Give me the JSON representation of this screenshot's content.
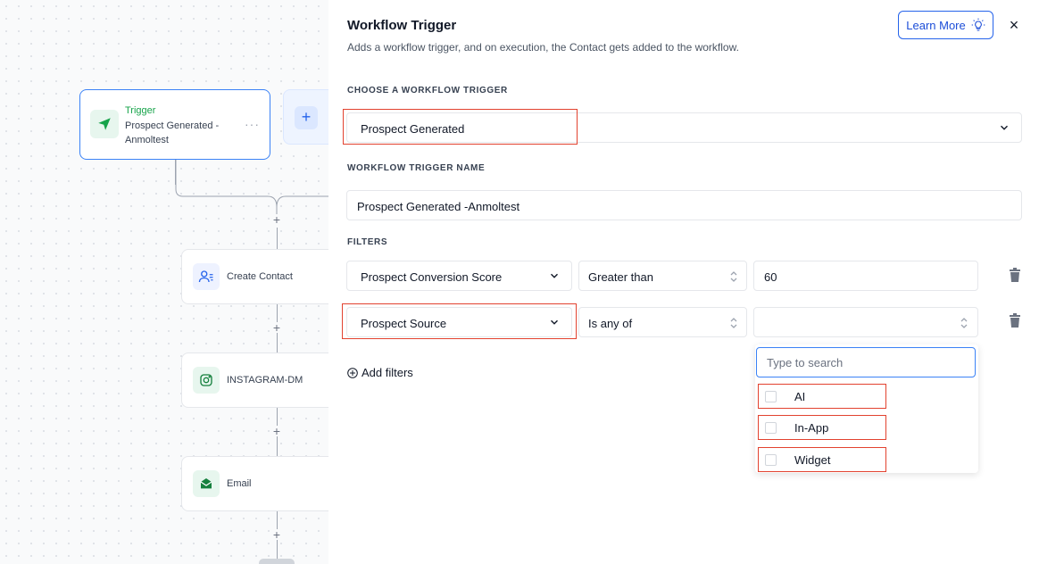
{
  "canvas": {
    "trigger_card": {
      "label": "Trigger",
      "name": "Prospect Generated -\nAnmoltest",
      "more": "···"
    },
    "add_node": "+",
    "plus_sign": "+",
    "nodes": [
      {
        "label": "Create Contact",
        "icon": "user-list-icon",
        "accent": "#eef2ff"
      },
      {
        "label": "INSTAGRAM-DM",
        "icon": "instagram-icon",
        "accent": "#e7f6ee"
      },
      {
        "label": "Email",
        "icon": "mail-open-icon",
        "accent": "#e7f6ee"
      }
    ]
  },
  "panel": {
    "title": "Workflow Trigger",
    "subtitle": "Adds a workflow trigger, and on execution, the Contact gets added to the workflow.",
    "learn_more": "Learn More",
    "close": "×",
    "choose_label": "CHOOSE A WORKFLOW TRIGGER",
    "trigger_select": "Prospect Generated",
    "name_label": "WORKFLOW TRIGGER NAME",
    "trigger_name_value": "Prospect Generated -Anmoltest",
    "filters_label": "FILTERS",
    "filters": [
      {
        "field": "Prospect Conversion Score",
        "operator": "Greater than",
        "value": "60"
      },
      {
        "field": "Prospect Source",
        "operator": "Is any of",
        "value": ""
      }
    ],
    "add_filters": "Add filters",
    "dropdown": {
      "search_placeholder": "Type to search",
      "options": [
        "AI",
        "In-App",
        "Widget"
      ]
    }
  },
  "colors": {
    "accent": "#2563eb",
    "highlight": "#e2422f",
    "brand_green": "#16a34a"
  }
}
